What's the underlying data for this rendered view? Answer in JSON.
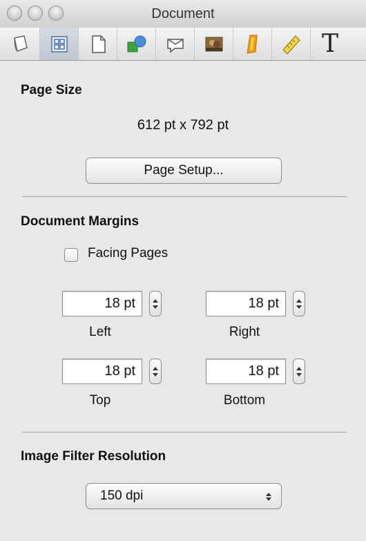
{
  "window": {
    "title": "Document"
  },
  "toolbar": {
    "tabs": [
      {
        "icon": "pages-icon",
        "selected": false
      },
      {
        "icon": "grid-layout-icon",
        "selected": true
      },
      {
        "icon": "page-icon",
        "selected": false
      },
      {
        "icon": "shapes-icon",
        "selected": false
      },
      {
        "icon": "comment-bubble-icon",
        "selected": false
      },
      {
        "icon": "photo-icon",
        "selected": false
      },
      {
        "icon": "highlighter-icon",
        "selected": false
      },
      {
        "icon": "ruler-icon",
        "selected": false
      },
      {
        "icon": "text-icon",
        "selected": false,
        "glyph": "T"
      }
    ]
  },
  "page_size": {
    "heading": "Page Size",
    "value": "612 pt x 792 pt",
    "setup_button": "Page Setup..."
  },
  "margins": {
    "heading": "Document Margins",
    "facing_pages_label": "Facing Pages",
    "facing_pages_checked": false,
    "left": {
      "value": "18 pt",
      "label": "Left"
    },
    "right": {
      "value": "18 pt",
      "label": "Right"
    },
    "top": {
      "value": "18 pt",
      "label": "Top"
    },
    "bottom": {
      "value": "18 pt",
      "label": "Bottom"
    }
  },
  "image_filter": {
    "heading": "Image Filter Resolution",
    "selected": "150 dpi"
  },
  "colors": {
    "panel_bg": "#e8e8e8",
    "selected_tab": "#c6ccd5",
    "separator": "#9f9f9f"
  }
}
